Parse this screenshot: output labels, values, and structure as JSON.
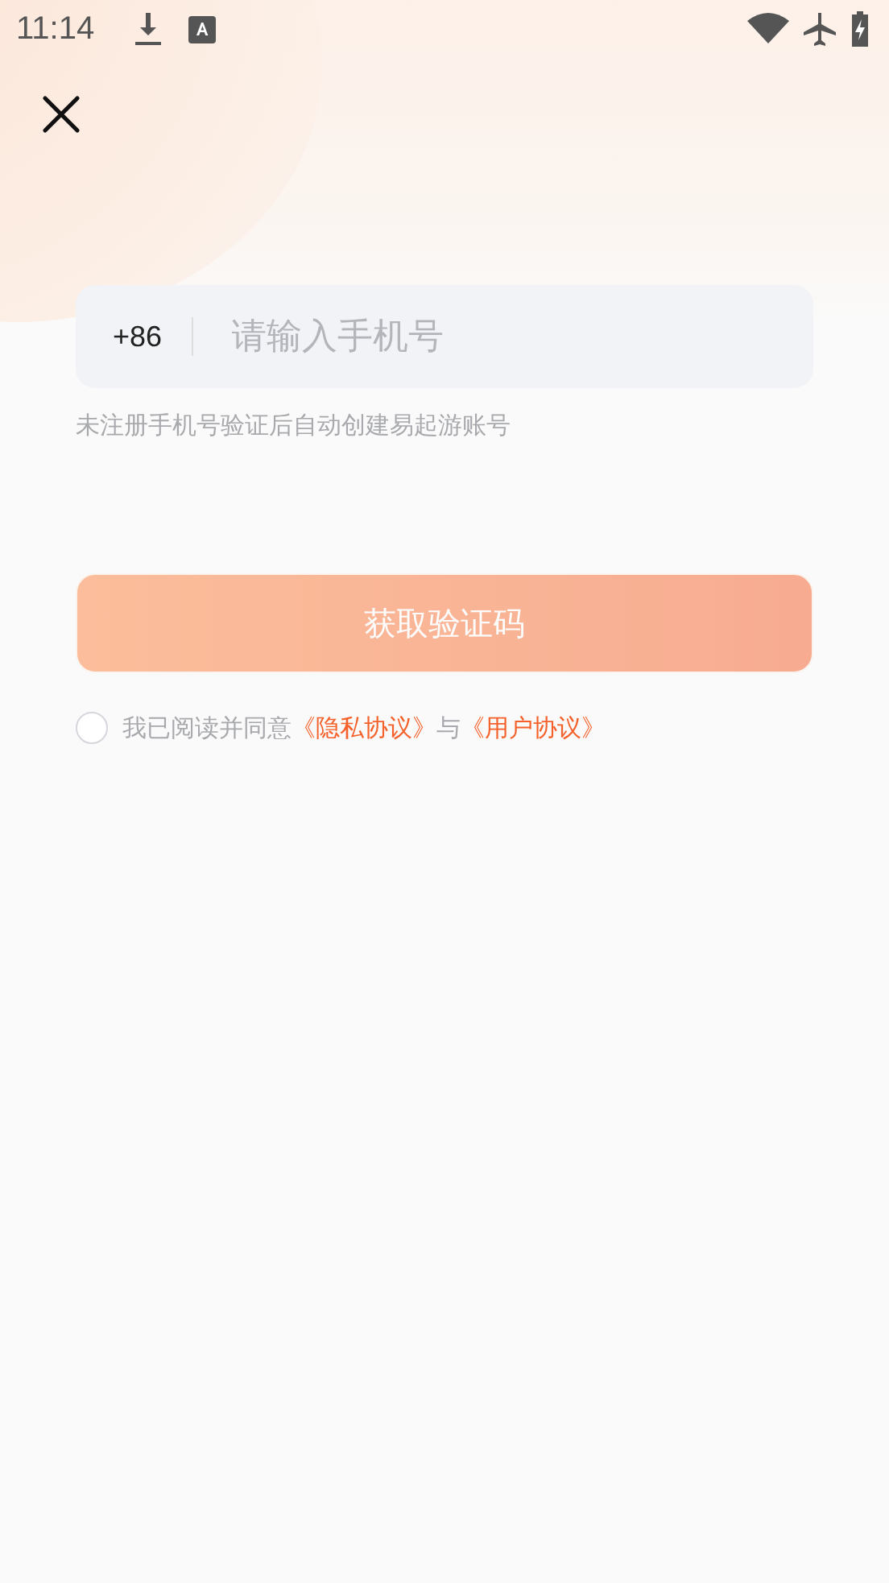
{
  "status_bar": {
    "time": "11:14"
  },
  "phone_field": {
    "country_code": "+86",
    "placeholder": "请输入手机号"
  },
  "hint": "未注册手机号验证后自动创建易起游账号",
  "get_code_button": {
    "label": "获取验证码",
    "disabled": true
  },
  "agreement": {
    "checked": false,
    "text": "我已阅读并同意",
    "links": [
      {
        "label": "《隐私协议》"
      },
      {
        "label": "《用户协议》"
      }
    ],
    "joiner": "与"
  }
}
